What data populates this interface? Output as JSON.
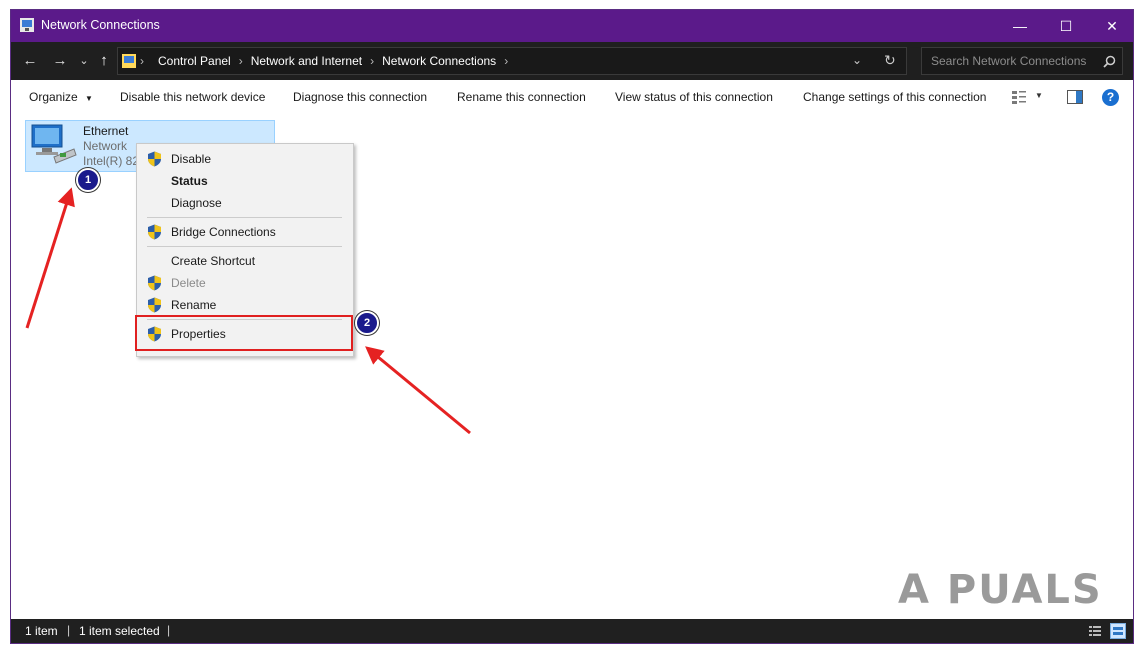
{
  "window": {
    "title": "Network Connections"
  },
  "address": {
    "crumbs": [
      "Control Panel",
      "Network and Internet",
      "Network Connections"
    ]
  },
  "search": {
    "placeholder": "Search Network Connections"
  },
  "toolbar": {
    "organize": "Organize",
    "disable": "Disable this network device",
    "diagnose": "Diagnose this connection",
    "rename": "Rename this connection",
    "view_status": "View status of this connection",
    "change_settings": "Change settings of this connection"
  },
  "item": {
    "name": "Ethernet",
    "status": "Network",
    "device": "Intel(R) 82"
  },
  "context_menu": {
    "disable": "Disable",
    "status": "Status",
    "diagnose": "Diagnose",
    "bridge": "Bridge Connections",
    "shortcut": "Create Shortcut",
    "delete": "Delete",
    "rename": "Rename",
    "properties": "Properties"
  },
  "annotations": {
    "badge1": "1",
    "badge2": "2"
  },
  "statusbar": {
    "count": "1 item",
    "selected": "1 item selected"
  },
  "watermark": "A PUALS",
  "colors": {
    "titlebar": "#5b1a8a",
    "selection": "#cce8ff",
    "highlight_box": "#e02020",
    "badge": "#1a1a8c"
  }
}
